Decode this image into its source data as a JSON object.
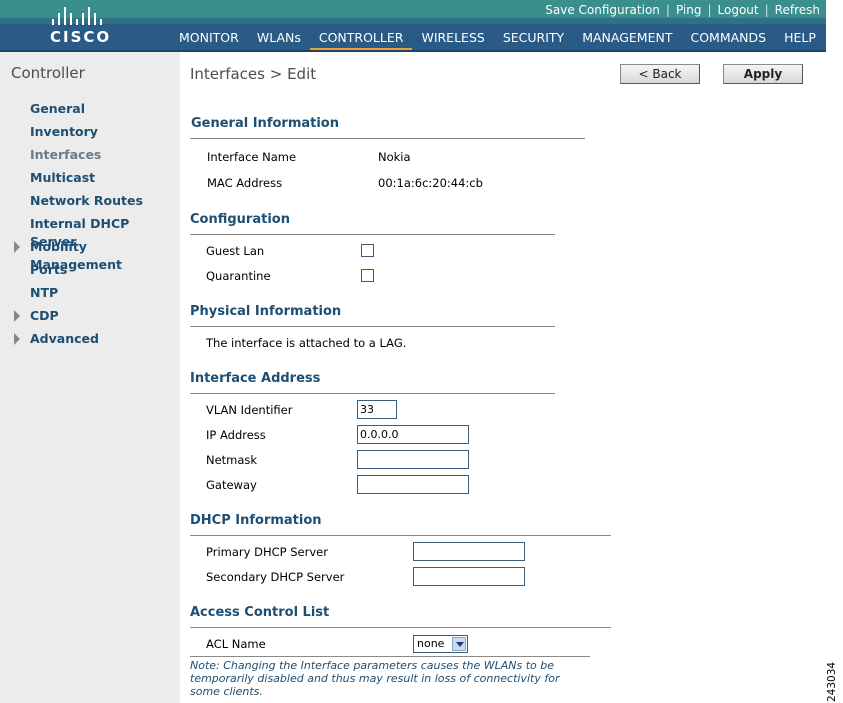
{
  "header": {
    "logo_text": "CISCO",
    "utility_links": [
      "Save Configuration",
      "Ping",
      "Logout",
      "Refresh"
    ],
    "nav": [
      "MONITOR",
      "WLANs",
      "CONTROLLER",
      "WIRELESS",
      "SECURITY",
      "MANAGEMENT",
      "COMMANDS",
      "HELP"
    ],
    "active_nav": "CONTROLLER",
    "accent_color": "#e8a23b",
    "bar_color": "#2a5b86"
  },
  "sidebar": {
    "title": "Controller",
    "items": [
      {
        "label": "General"
      },
      {
        "label": "Inventory"
      },
      {
        "label": "Interfaces"
      },
      {
        "label": "Multicast"
      },
      {
        "label": "Network Routes"
      },
      {
        "label": "Internal DHCP Server"
      },
      {
        "label": "Mobility Management"
      },
      {
        "label": "Ports"
      },
      {
        "label": "NTP"
      },
      {
        "label": "CDP"
      },
      {
        "label": "Advanced"
      }
    ]
  },
  "page": {
    "title": "Interfaces > Edit",
    "back_label": "< Back",
    "apply_label": "Apply"
  },
  "general": {
    "title": "General Information",
    "name_label": "Interface Name",
    "name_value": "Nokia",
    "mac_label": "MAC Address",
    "mac_value": "00:1a:6c:20:44:cb"
  },
  "configuration": {
    "title": "Configuration",
    "guest_lan_label": "Guest Lan",
    "quarantine_label": "Quarantine"
  },
  "physical": {
    "title": "Physical Information",
    "text": "The interface is attached to a LAG."
  },
  "address": {
    "title": "Interface Address",
    "vlan_label": "VLAN Identifier",
    "vlan_value": "33",
    "ip_label": "IP Address",
    "ip_value": "0.0.0.0",
    "netmask_label": "Netmask",
    "netmask_value": "",
    "gateway_label": "Gateway",
    "gateway_value": ""
  },
  "dhcp": {
    "title": "DHCP Information",
    "primary_label": "Primary DHCP Server",
    "primary_value": "",
    "secondary_label": "Secondary DHCP Server",
    "secondary_value": ""
  },
  "acl": {
    "title": "Access Control List",
    "name_label": "ACL Name",
    "selected": "none"
  },
  "note": "Note: Changing the Interface parameters causes the WLANs to be temporarily disabled and thus may result in loss of connectivity for some clients.",
  "figure_id": "243034"
}
